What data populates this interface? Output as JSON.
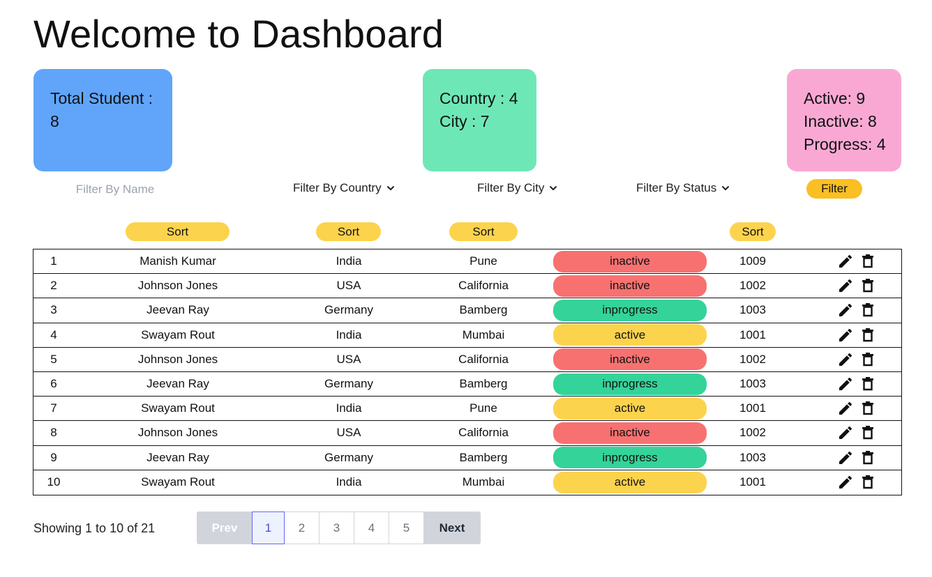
{
  "page": {
    "title": "Welcome to Dashboard"
  },
  "cards": {
    "total": {
      "line1": "Total Student :",
      "line2": "8",
      "color": "#60a5fa"
    },
    "location": {
      "line1": "Country : 4",
      "line2": "City : 7",
      "color": "#6ee7b7"
    },
    "status": {
      "line1": "Active: 9",
      "line2": "Inactive: 8",
      "line3": "Progress: 4",
      "color": "#f9a8d4"
    }
  },
  "filters": {
    "name_placeholder": "Filter By Name",
    "country_label": "Filter By Country",
    "city_label": "Filter By City",
    "status_label": "Filter By Status",
    "filter_button": "Filter"
  },
  "sort": {
    "label": "Sort"
  },
  "status_colors": {
    "inactive": "#f87171",
    "inprogress": "#34d399",
    "active": "#fcd34d"
  },
  "table": {
    "rows": [
      {
        "idx": "1",
        "name": "Manish Kumar",
        "country": "India",
        "city": "Pune",
        "status": "inactive",
        "code": "1009"
      },
      {
        "idx": "2",
        "name": "Johnson Jones",
        "country": "USA",
        "city": "California",
        "status": "inactive",
        "code": "1002"
      },
      {
        "idx": "3",
        "name": "Jeevan Ray",
        "country": "Germany",
        "city": "Bamberg",
        "status": "inprogress",
        "code": "1003"
      },
      {
        "idx": "4",
        "name": "Swayam Rout",
        "country": "India",
        "city": "Mumbai",
        "status": "active",
        "code": "1001"
      },
      {
        "idx": "5",
        "name": "Johnson Jones",
        "country": "USA",
        "city": "California",
        "status": "inactive",
        "code": "1002"
      },
      {
        "idx": "6",
        "name": "Jeevan Ray",
        "country": "Germany",
        "city": "Bamberg",
        "status": "inprogress",
        "code": "1003"
      },
      {
        "idx": "7",
        "name": "Swayam Rout",
        "country": "India",
        "city": "Pune",
        "status": "active",
        "code": "1001"
      },
      {
        "idx": "8",
        "name": "Johnson Jones",
        "country": "USA",
        "city": "California",
        "status": "inactive",
        "code": "1002"
      },
      {
        "idx": "9",
        "name": "Jeevan Ray",
        "country": "Germany",
        "city": "Bamberg",
        "status": "inprogress",
        "code": "1003"
      },
      {
        "idx": "10",
        "name": "Swayam Rout",
        "country": "India",
        "city": "Mumbai",
        "status": "active",
        "code": "1001"
      }
    ],
    "action_icons": [
      "pencil-icon",
      "trash-icon"
    ]
  },
  "pagination": {
    "showing": "Showing 1 to 10 of 21",
    "prev": "Prev",
    "pages": [
      "1",
      "2",
      "3",
      "4",
      "5"
    ],
    "active_page": "1",
    "next": "Next"
  }
}
